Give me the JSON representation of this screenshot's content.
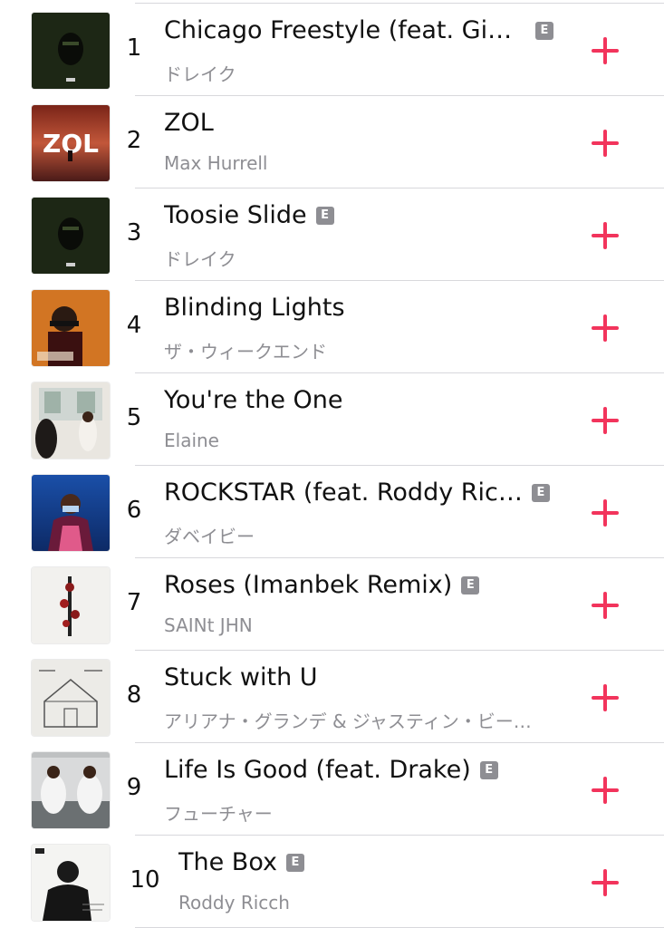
{
  "accent_color": "#f2345c",
  "explicit_label": "E",
  "tracks": [
    {
      "rank": "1",
      "title": "Chicago Freestyle (feat. Giv…",
      "artist": "ドレイク",
      "explicit": true,
      "art": "dark-green-hooded-figure"
    },
    {
      "rank": "2",
      "title": "ZOL",
      "artist": "Max Hurrell",
      "explicit": false,
      "art": "red-sky-zol"
    },
    {
      "rank": "3",
      "title": "Toosie Slide",
      "artist": "ドレイク",
      "explicit": true,
      "art": "dark-green-hooded-figure"
    },
    {
      "rank": "4",
      "title": "Blinding Lights",
      "artist": "ザ・ウィークエンド",
      "explicit": false,
      "art": "orange-portrait"
    },
    {
      "rank": "5",
      "title": "You're the One",
      "artist": "Elaine",
      "explicit": false,
      "art": "white-room-people"
    },
    {
      "rank": "6",
      "title": "ROCKSTAR (feat. Roddy Ric…",
      "artist": "ダベイビー",
      "explicit": true,
      "art": "blue-masked-figure"
    },
    {
      "rank": "7",
      "title": "Roses (Imanbek Remix)",
      "artist": "SAINt JHN",
      "explicit": true,
      "art": "white-roses"
    },
    {
      "rank": "8",
      "title": "Stuck with U",
      "artist": "アリアナ・グランデ & ジャスティン・ビー…",
      "explicit": false,
      "art": "sketch-house"
    },
    {
      "rank": "9",
      "title": "Life Is Good (feat. Drake)",
      "artist": "フューチャー",
      "explicit": true,
      "art": "kitchen-workers"
    },
    {
      "rank": "10",
      "title": "The Box",
      "artist": "Roddy Ricch",
      "explicit": true,
      "art": "bw-portrait"
    }
  ]
}
